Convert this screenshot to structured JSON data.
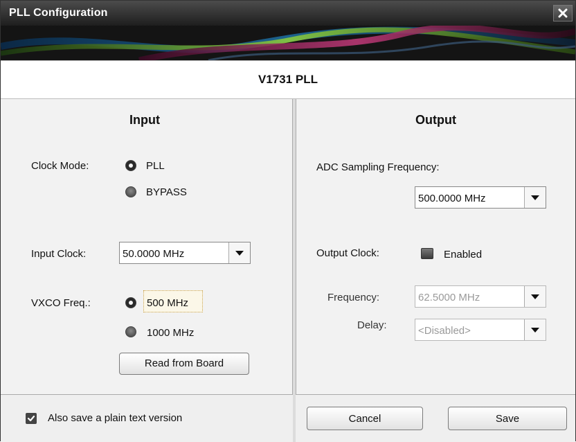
{
  "window": {
    "title": "PLL Configuration",
    "close_icon": "close-icon"
  },
  "header": {
    "title": "V1731 PLL"
  },
  "input": {
    "section_title": "Input",
    "clock_mode": {
      "label": "Clock Mode:",
      "options": [
        {
          "label": "PLL",
          "selected": true
        },
        {
          "label": "BYPASS",
          "selected": false
        }
      ]
    },
    "input_clock": {
      "label": "Input Clock:",
      "value": "50.0000 MHz"
    },
    "vxco_freq": {
      "label": "VXCO Freq.:",
      "options": [
        {
          "label": "500 MHz",
          "selected": true
        },
        {
          "label": "1000 MHz",
          "selected": false
        }
      ]
    },
    "read_button": "Read from Board"
  },
  "output": {
    "section_title": "Output",
    "adc_sampling": {
      "label": "ADC Sampling Frequency:",
      "value": "500.0000 MHz"
    },
    "output_clock": {
      "label": "Output Clock:",
      "toggle_label": "Enabled"
    },
    "frequency": {
      "label": "Frequency:",
      "value": "62.5000 MHz",
      "disabled": true
    },
    "delay": {
      "label": "Delay:",
      "value": "<Disabled>",
      "disabled": true
    }
  },
  "footer": {
    "checkbox_label": "Also save a plain text version",
    "checkbox_checked": true,
    "cancel_label": "Cancel",
    "save_label": "Save"
  }
}
